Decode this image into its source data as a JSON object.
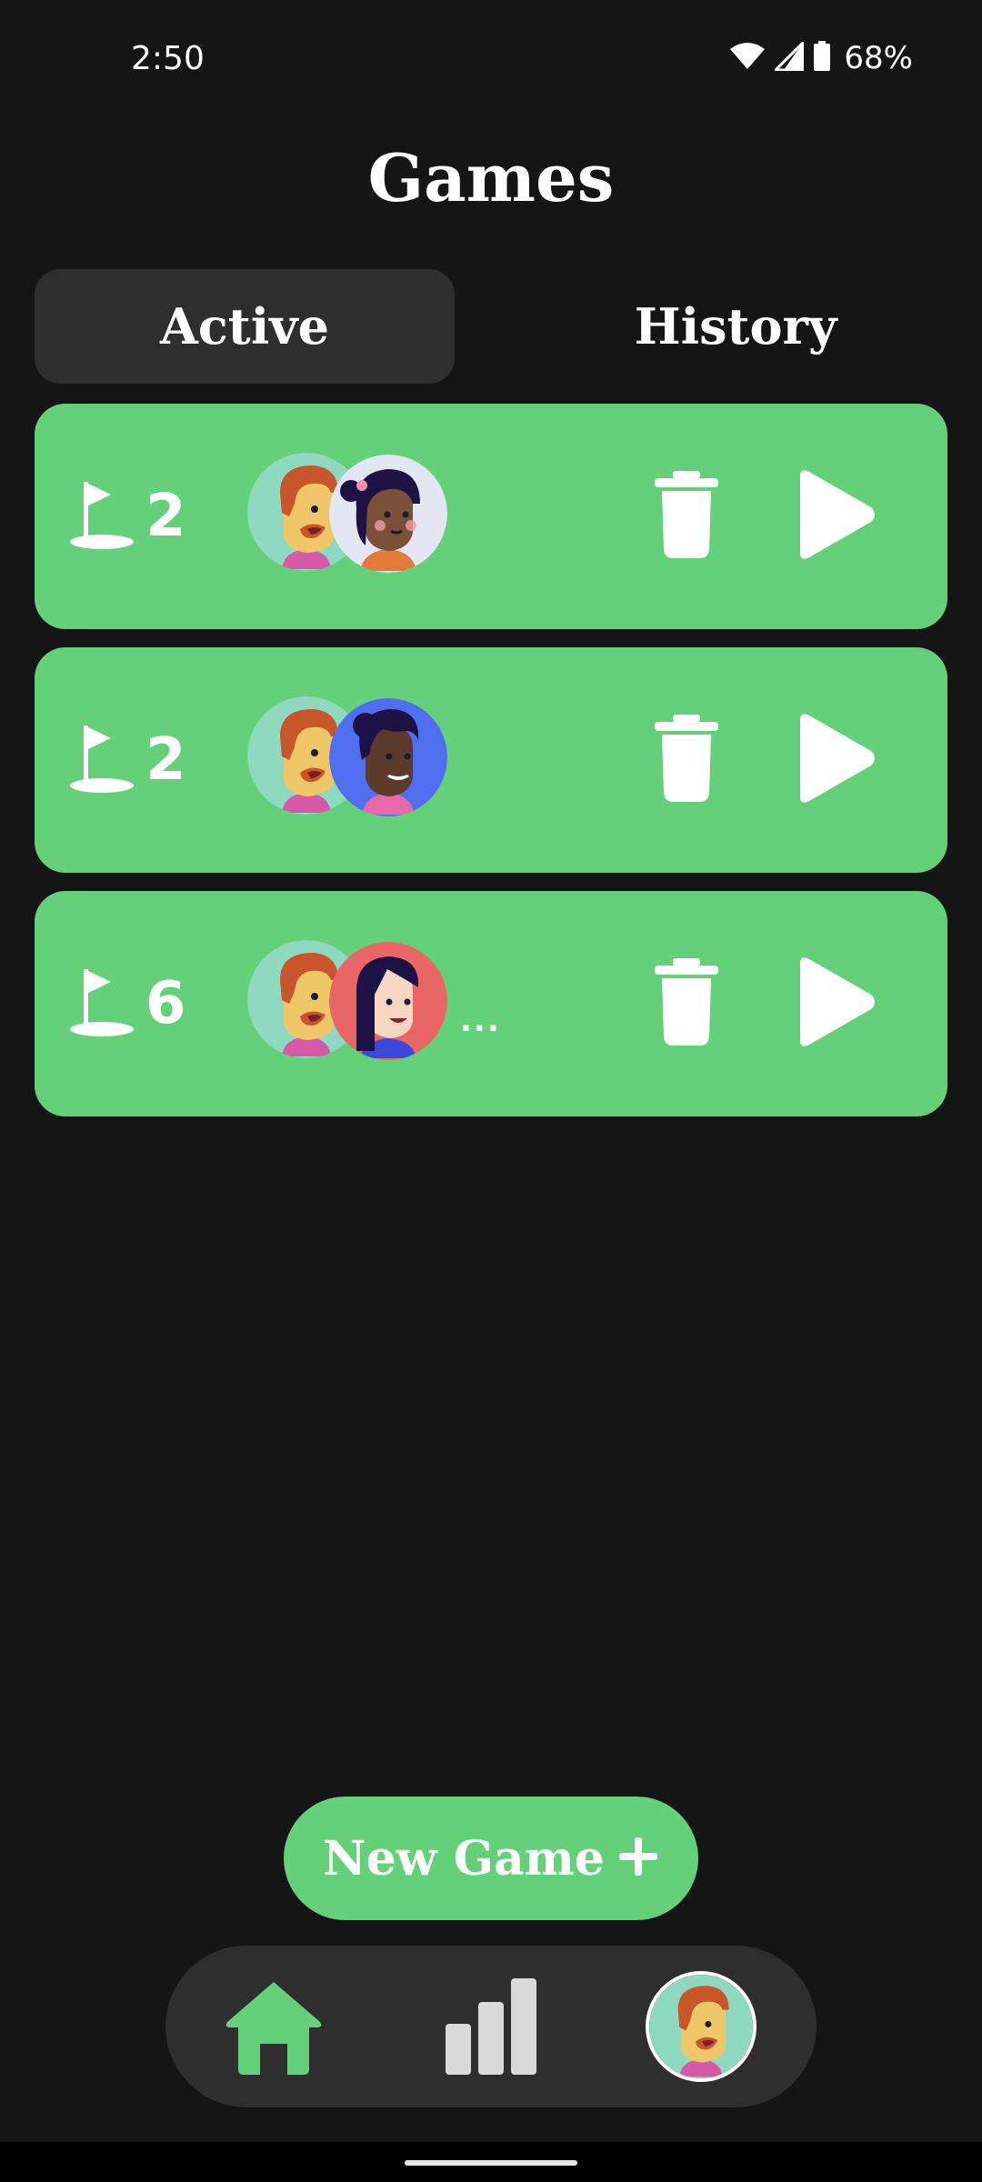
{
  "status_bar": {
    "time": "2:50",
    "battery": "68%",
    "icons": [
      "wifi-icon",
      "cellular-signal-icon",
      "battery-icon"
    ]
  },
  "header": {
    "title": "Games"
  },
  "tabs": [
    {
      "label": "Active",
      "selected": true
    },
    {
      "label": "History",
      "selected": false
    }
  ],
  "games": [
    {
      "holes": "2",
      "players": [
        "player-avatar-red-hair-man",
        "player-avatar-dark-hair-woman-light-bg"
      ],
      "more": ""
    },
    {
      "holes": "2",
      "players": [
        "player-avatar-red-hair-man",
        "player-avatar-dark-hair-man-blue-bg"
      ],
      "more": ""
    },
    {
      "holes": "6",
      "players": [
        "player-avatar-red-hair-man",
        "player-avatar-dark-hair-woman-red-bg"
      ],
      "more": "..."
    }
  ],
  "new_game": {
    "label": "New Game",
    "icon": "plus-icon"
  },
  "bottom_nav": {
    "items": [
      "home-icon",
      "stats-bar-chart-icon",
      "profile-avatar"
    ]
  },
  "colors": {
    "background": "#151515",
    "card": "#64d17a",
    "tab_active_bg": "#2e2e2f",
    "nav_bg": "#2e2e2f",
    "text": "#ffffff"
  }
}
